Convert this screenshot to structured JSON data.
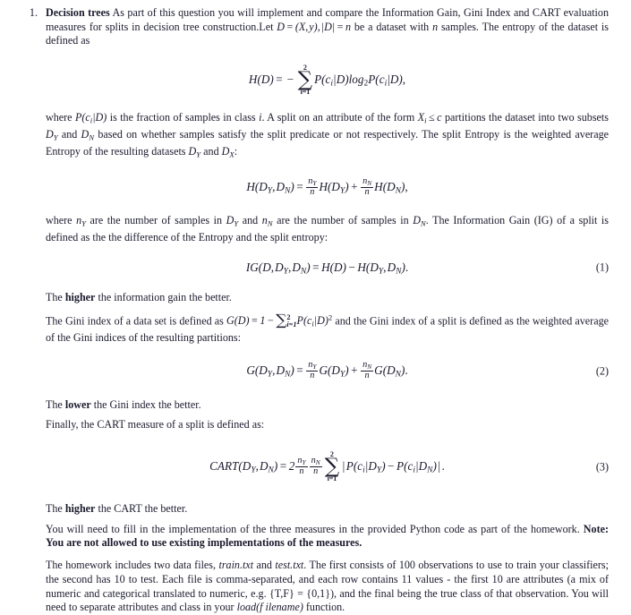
{
  "document": {
    "list_number": "1.",
    "question_title": "Decision trees",
    "intro": {
      "part1": " As part of this question you will implement and compare the Information Gain, Gini Index and CART evaluation measures for splits in decision tree construction.Let ",
      "math_D": "D = (X, y), |D| = n",
      "part2": " be a dataset with ",
      "math_n": "n",
      "part3": " samples. The entropy of the dataset is defined as"
    },
    "equations": {
      "entropy": {
        "lhs": "H(D)",
        "equals": "=",
        "minus": "−",
        "sum_upper": "2",
        "sum_lower": "i=1",
        "sigma": "∑",
        "body": "P(c",
        "body_sub": "i",
        "body_mid": "|D)log",
        "log_base": "2",
        "body_end": "P(c",
        "body_end_sub": "i",
        "body_tail": "|D),",
        "number": ""
      },
      "split_entropy": {
        "number": ""
      },
      "ig": {
        "number": "(1)"
      },
      "gini_split": {
        "number": "(2)"
      },
      "cart": {
        "number": "(3)"
      }
    },
    "paragraphs": {
      "p_where_P": {
        "a": "where ",
        "m1": "P(c",
        "m1sub": "i",
        "m1end": "|D)",
        "b": " is the fraction of samples in class ",
        "m2": "i",
        "c": ". A split on an attribute of the form ",
        "m3": "X",
        "m3sub": "i",
        "m3b": " ≤ c",
        "d": " partitions the dataset into two subsets ",
        "m4": "D",
        "m4sub": "Y",
        "e": " and ",
        "m5": "D",
        "m5sub": "N",
        "f": " based on whether samples satisfy the split predicate or not respectively. The split Entropy is the weighted average Entropy of the resulting datasets ",
        "m6": "D",
        "m6sub": "Y",
        "g": " and ",
        "m7": "D",
        "m7sub": "X",
        "h": ":"
      },
      "p_where_n": {
        "a": "where ",
        "m1": "n",
        "m1sub": "Y",
        "b": " are the number of samples in ",
        "m2": "D",
        "m2sub": "Y",
        "c": " and ",
        "m3": "n",
        "m3sub": "N",
        "d": " are the number of samples in ",
        "m4": "D",
        "m4sub": "N",
        "e": ". The Information Gain (IG) of a split is defined as the the difference of the Entropy and the split entropy:"
      },
      "p_higher_ig": {
        "a": "The ",
        "bold": "higher",
        "b": " the information gain the better."
      },
      "p_gini": {
        "a": "The Gini index of a data set is defined as ",
        "m_lhs": "G(D) = 1 −",
        "m_sum_upper": "2",
        "m_sum_lower": "i=1",
        "m_body": "P(c",
        "m_body_sub": "i",
        "m_body_end": "|D)",
        "m_body_sup": "2",
        "b": " and the Gini index of a split is defined as the weighted average of the Gini indices of the resulting partitions:"
      },
      "p_lower_gini": {
        "a": "The ",
        "bold": "lower",
        "b": " the Gini index the better."
      },
      "p_finally": "Finally, the CART measure of a split is defined as:",
      "p_higher_cart": {
        "a": "The ",
        "bold": "higher",
        "b": " the CART the better."
      },
      "p_fill_in": {
        "a": "You will need to fill in the implementation of the three measures in the provided Python code as part of the homework. ",
        "bold": "Note: You are not allowed to use existing implementations of the measures."
      },
      "p_data_files": {
        "a": "The homework includes two data files, ",
        "it1": "train.txt",
        "b": " and ",
        "it2": "test.txt",
        "c": ". The first consists of 100 observations to use to train your classifiers; the second has 10 to test. Each file is comma-separated, and each row contains 11 values - the first 10 are attributes (a mix of numeric and categorical translated to numeric, e.g. {T,F} = {0,1}), and the final being the true class of that observation. You will need to separate attributes and class in your ",
        "it3": "load(",
        "it3b": "filename",
        "it3c": ")",
        "d": " function."
      }
    },
    "symbols": {
      "sigma": "∑",
      "minus": "−",
      "leq": "≤",
      "equals": "=",
      "plus": "+",
      "bar": "|"
    },
    "colors": {
      "text": "#1b1b2e",
      "background": "#ffffff"
    }
  }
}
